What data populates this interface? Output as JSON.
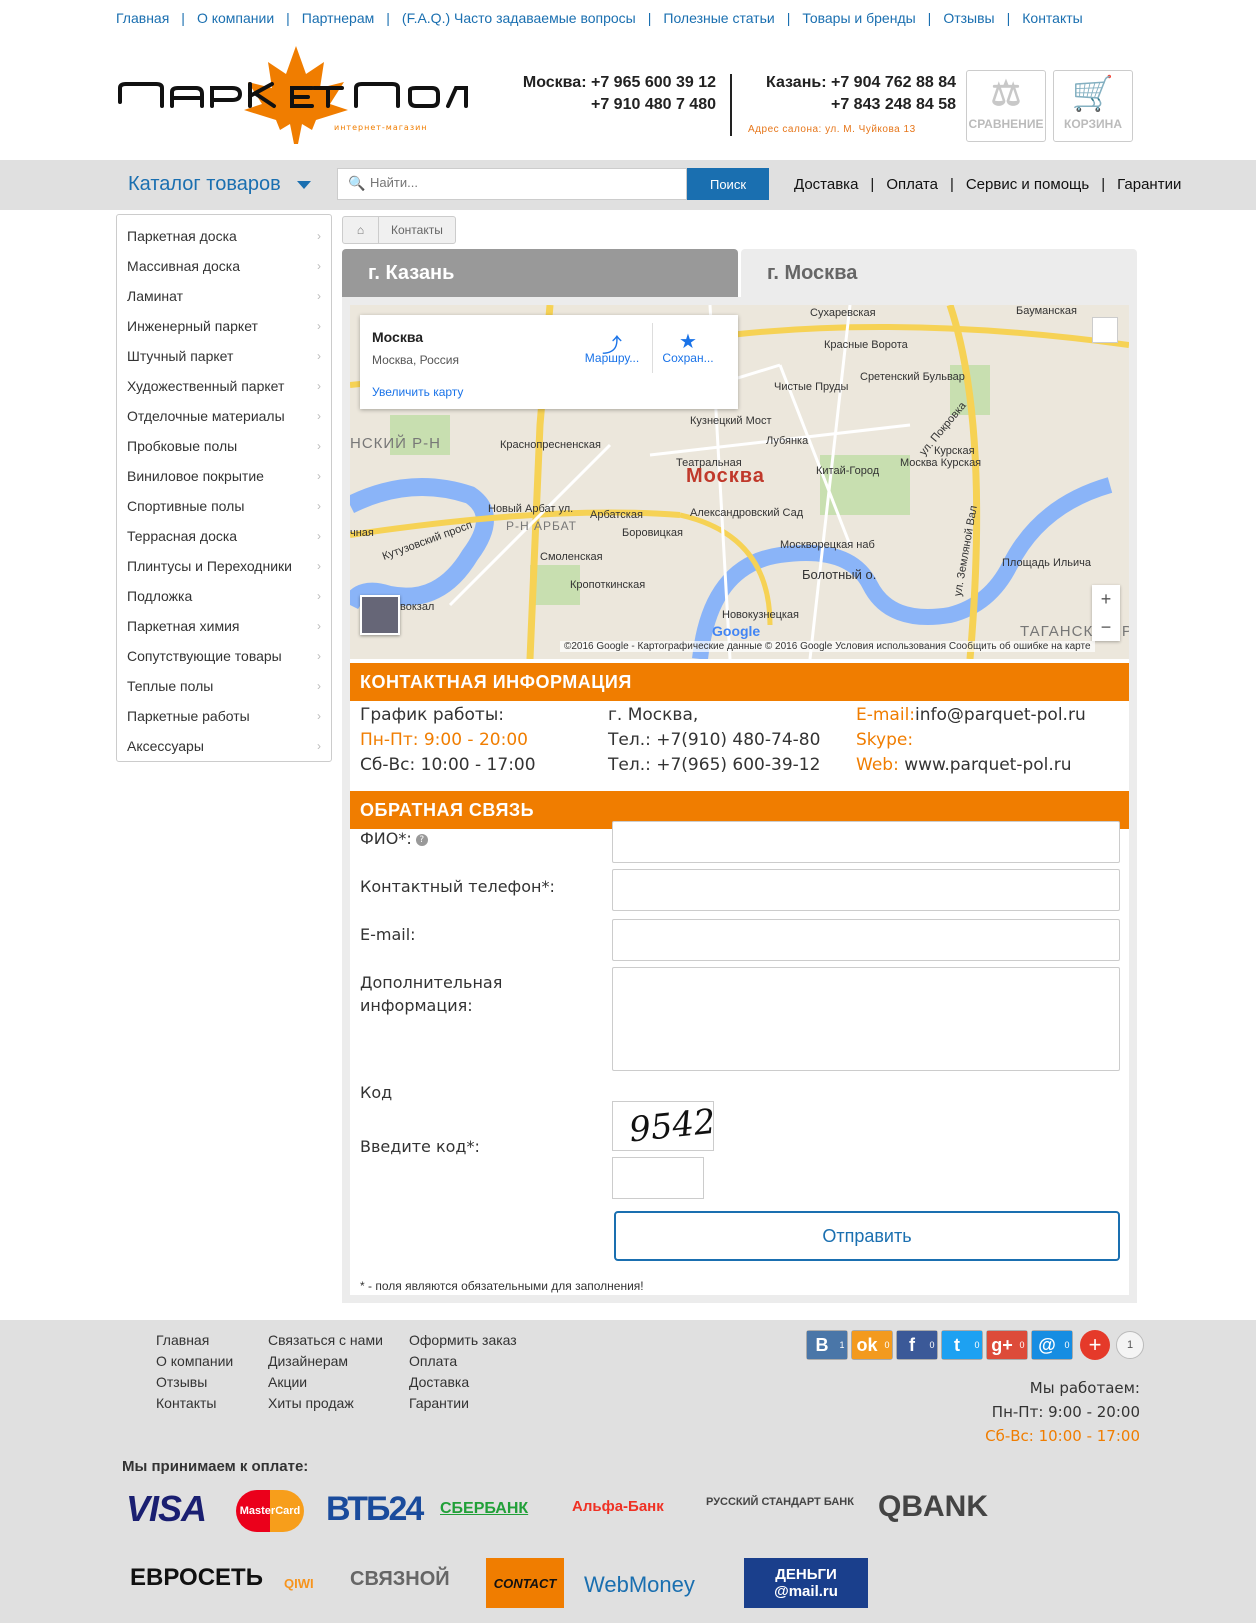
{
  "topnav": [
    "Главная",
    "О компании",
    "Партнерам",
    "(F.A.Q.) Часто задаваемые вопросы",
    "Полезные статьи",
    "Товары и бренды",
    "Отзывы",
    "Контакты"
  ],
  "logo": {
    "name": "Паркет Пол",
    "tagline": "интернет-магазин",
    "accent": "#f07d00"
  },
  "phones": {
    "moscow_label": "Москва:",
    "moscow_1": "+7 965 600 39 12",
    "moscow_2": "+7 910 480 7 480",
    "kazan_label": "Казань:",
    "kazan_1": "+7 904 762 88 84",
    "kazan_2": "+7 843 248 84 58",
    "address": "Адрес салона: ул. М. Чуйкова 13"
  },
  "header_buttons": {
    "compare": "СРАВНЕНИЕ",
    "compare_icon": "scales-icon",
    "cart": "КОРЗИНА",
    "cart_icon": "cart-icon"
  },
  "catalog_label": "Каталог товаров",
  "search": {
    "placeholder": "Найти...",
    "button": "Поиск"
  },
  "barlinks": [
    "Доставка",
    "Оплата",
    "Сервис и помощь",
    "Гарантии"
  ],
  "sidebar": [
    "Паркетная доска",
    "Массивная доска",
    "Ламинат",
    "Инженерный паркет",
    "Штучный паркет",
    "Художественный паркет",
    "Отделочные материалы",
    "Пробковые полы",
    "Виниловое покрытие",
    "Спортивные полы",
    "Террасная доска",
    "Плинтусы и Переходники",
    "Подложка",
    "Паркетная химия",
    "Сопутствующие товары",
    "Теплые полы",
    "Паркетные работы",
    "Аксессуары"
  ],
  "breadcrumb": {
    "current": "Контакты"
  },
  "tabs": {
    "kazan": "г. Казань",
    "moscow": "г. Москва"
  },
  "map": {
    "card_title": "Москва",
    "card_subtitle": "Москва, Россия",
    "card_link": "Увеличить карту",
    "route": "Маршру...",
    "save": "Сохран...",
    "footer": "©2016 Google - Картографические данные © 2016 Google   Условия использования   Сообщить об ошибке на карте",
    "google": "Google",
    "city": "Москва",
    "labels": [
      "Сухаревская",
      "Бауманская",
      "Красные Ворота",
      "Чистые Пруды",
      "Сретенский Бульвар",
      "Кузнецкий Мост",
      "Лубянка",
      "Краснопресненская",
      "Театральная",
      "Китай-Город",
      "Москва Курская",
      "Курская",
      "Новый Арбат ул.",
      "Арбатская",
      "Александровский Сад",
      "Боровицкая",
      "Смоленская",
      "Кропоткинская",
      "Москворецкая наб",
      "Болотный о.",
      "Новокузнецкая",
      "Площадь Ильича",
      "Кутузовский просп",
      "вокзал",
      "ул. Земляной Вал",
      "ул. Покровка",
      "Р-Н АРБАТ",
      "НСКИЙ Р-Н",
      "ТАГАНСКИЙ Р",
      "чная"
    ]
  },
  "contact": {
    "header": "КОНТАКТНАЯ ИНФОРМАЦИЯ",
    "schedule_label": "График работы:",
    "weekday": "Пн-Пт: 9:00 - 20:00",
    "weekend": "Сб-Вс: 10:00 - 17:00",
    "city": "г. Москва,",
    "tel1": "Тел.: +7(910) 480-74-80",
    "tel2": "Тел.: +7(965) 600-39-12",
    "email_label": "E-mail:",
    "email": "info@parquet-pol.ru",
    "skype_label": "Skype:",
    "web_label": "Web:",
    "web": "www.parquet-pol.ru"
  },
  "feedback": {
    "header": "ОБРАТНАЯ СВЯЗЬ",
    "fio": "ФИО*:",
    "phone": "Контактный телефон*:",
    "email": "E-mail:",
    "extra_1": "Дополнительная",
    "extra_2": "информация:",
    "code": "Код",
    "captcha": "9542",
    "enter_code": "Введите код*:",
    "submit": "Отправить",
    "note": "* - поля являются обязательными для заполнения!"
  },
  "footer": {
    "col1": [
      "Главная",
      "О компании",
      "Отзывы",
      "Контакты"
    ],
    "col2": [
      "Связаться с нами",
      "Дизайнерам",
      "Акции",
      "Хиты продаж"
    ],
    "col3": [
      "Оформить заказ",
      "Оплата",
      "Доставка",
      "Гарантии"
    ],
    "social": [
      {
        "icon": "B",
        "count": "1",
        "color": "#4a76a8"
      },
      {
        "icon": "ok",
        "count": "0",
        "color": "#f39a1e"
      },
      {
        "icon": "f",
        "count": "0",
        "color": "#3b5998"
      },
      {
        "icon": "t",
        "count": "0",
        "color": "#1da1f2"
      },
      {
        "icon": "g+",
        "count": "0",
        "color": "#dd4b39"
      },
      {
        "icon": "@",
        "count": "0",
        "color": "#168de2"
      }
    ],
    "share_count": "1",
    "work_label": "Мы работаем:",
    "work_weekday": "Пн-Пт: 9:00 - 20:00",
    "work_weekend": "Сб-Вс: 10:00 - 17:00",
    "accept_label": "Мы принимаем к оплате:",
    "payments_row1": [
      "VISA",
      "MasterCard",
      "ВТБ24",
      "СБЕРБАНК",
      "Альфа-Банк",
      "РУССКИЙ СТАНДАРТ БАНК",
      "QBANK"
    ],
    "payments_row2": [
      "ЕВРОСЕТЬ",
      "QIWI",
      "СВЯЗНОЙ",
      "CONTACT",
      "WebMoney",
      "ДЕНЬГИ @mail.ru"
    ]
  }
}
